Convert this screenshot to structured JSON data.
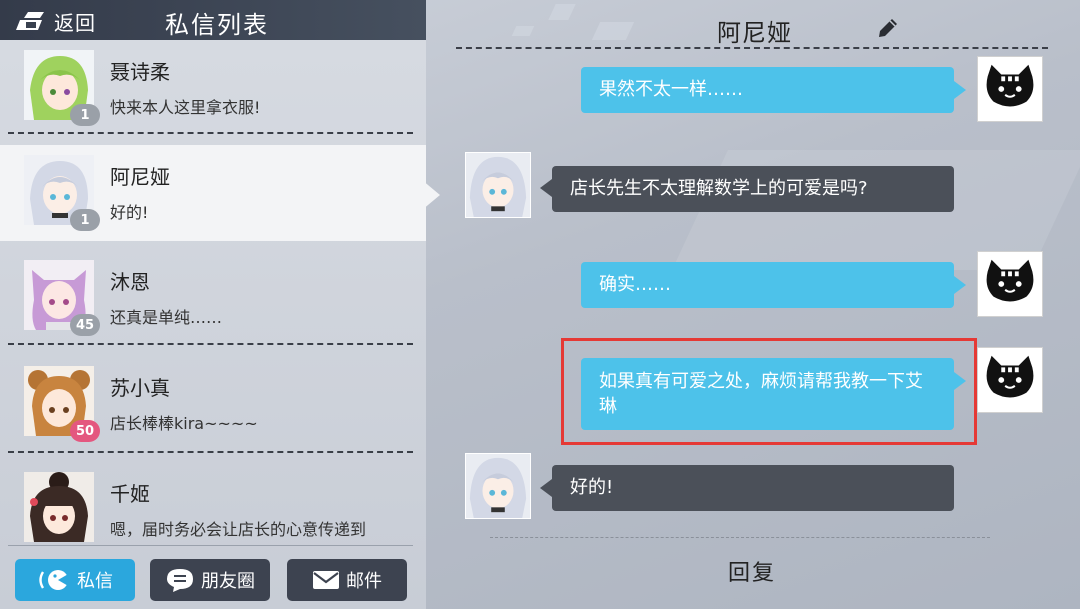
{
  "header": {
    "back_label": "返回",
    "list_title": "私信列表"
  },
  "contacts": [
    {
      "name": "聂诗柔",
      "preview": "快来本人这里拿衣服!",
      "badge": "1",
      "badge_color": "#9aa0a8",
      "hair": "#9fd25e",
      "active": false
    },
    {
      "name": "阿尼娅",
      "preview": "好的!",
      "badge": "1",
      "badge_color": "#9aa0a8",
      "hair": "#c9cfe0",
      "active": true
    },
    {
      "name": "沐恩",
      "preview": "还真是单纯……",
      "badge": "45",
      "badge_color": "#9aa0a8",
      "hair": "#c79ad6",
      "active": false
    },
    {
      "name": "苏小真",
      "preview": "店长棒棒kira~~~~",
      "badge": "50",
      "badge_color": "#e4577f",
      "hair": "#c8843f",
      "active": false
    },
    {
      "name": "千姬",
      "preview": "嗯，届时务必会让店长的心意传递到",
      "badge": "",
      "badge_color": "#e4577f",
      "hair": "#3b2a25",
      "active": false
    }
  ],
  "tabs": {
    "messages": "私信",
    "moments": "朋友圈",
    "mail": "邮件"
  },
  "chat": {
    "title": "阿尼娅",
    "reply_label": "回复",
    "messages": [
      {
        "from": "me",
        "text": "果然不太一样……"
      },
      {
        "from": "them",
        "text": "店长先生不太理解数学上的可爱是吗?"
      },
      {
        "from": "me",
        "text": "确实……"
      },
      {
        "from": "me",
        "text": "如果真有可爱之处，麻烦请帮我教一下艾琳"
      },
      {
        "from": "them",
        "text": "好的!"
      }
    ]
  },
  "colors": {
    "accent_blue": "#4dc2ea",
    "bubble_dark": "#4b5059",
    "highlight": "#e53935",
    "tab_active": "#2ba7dd",
    "tab_inactive": "#3d4350"
  }
}
